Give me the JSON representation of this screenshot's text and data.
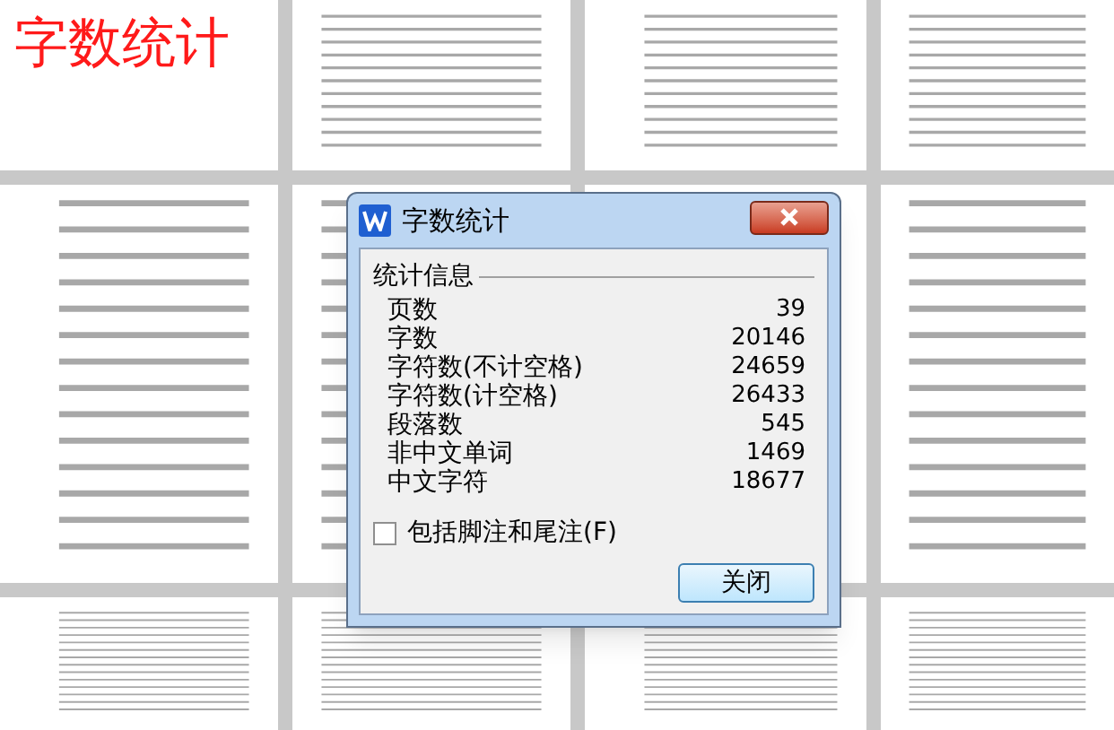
{
  "page_caption": "字数统计",
  "dialog": {
    "title": "字数统计",
    "group_label": "统计信息",
    "stats": [
      {
        "label": "页数",
        "value": "39"
      },
      {
        "label": "字数",
        "value": "20146"
      },
      {
        "label": "字符数(不计空格)",
        "value": "24659"
      },
      {
        "label": "字符数(计空格)",
        "value": "26433"
      },
      {
        "label": "段落数",
        "value": "545"
      },
      {
        "label": "非中文单词",
        "value": "1469"
      },
      {
        "label": "中文字符",
        "value": "18677"
      }
    ],
    "checkbox": {
      "label": "包括脚注和尾注(F)",
      "checked": false
    },
    "buttons": [
      "关闭"
    ]
  }
}
